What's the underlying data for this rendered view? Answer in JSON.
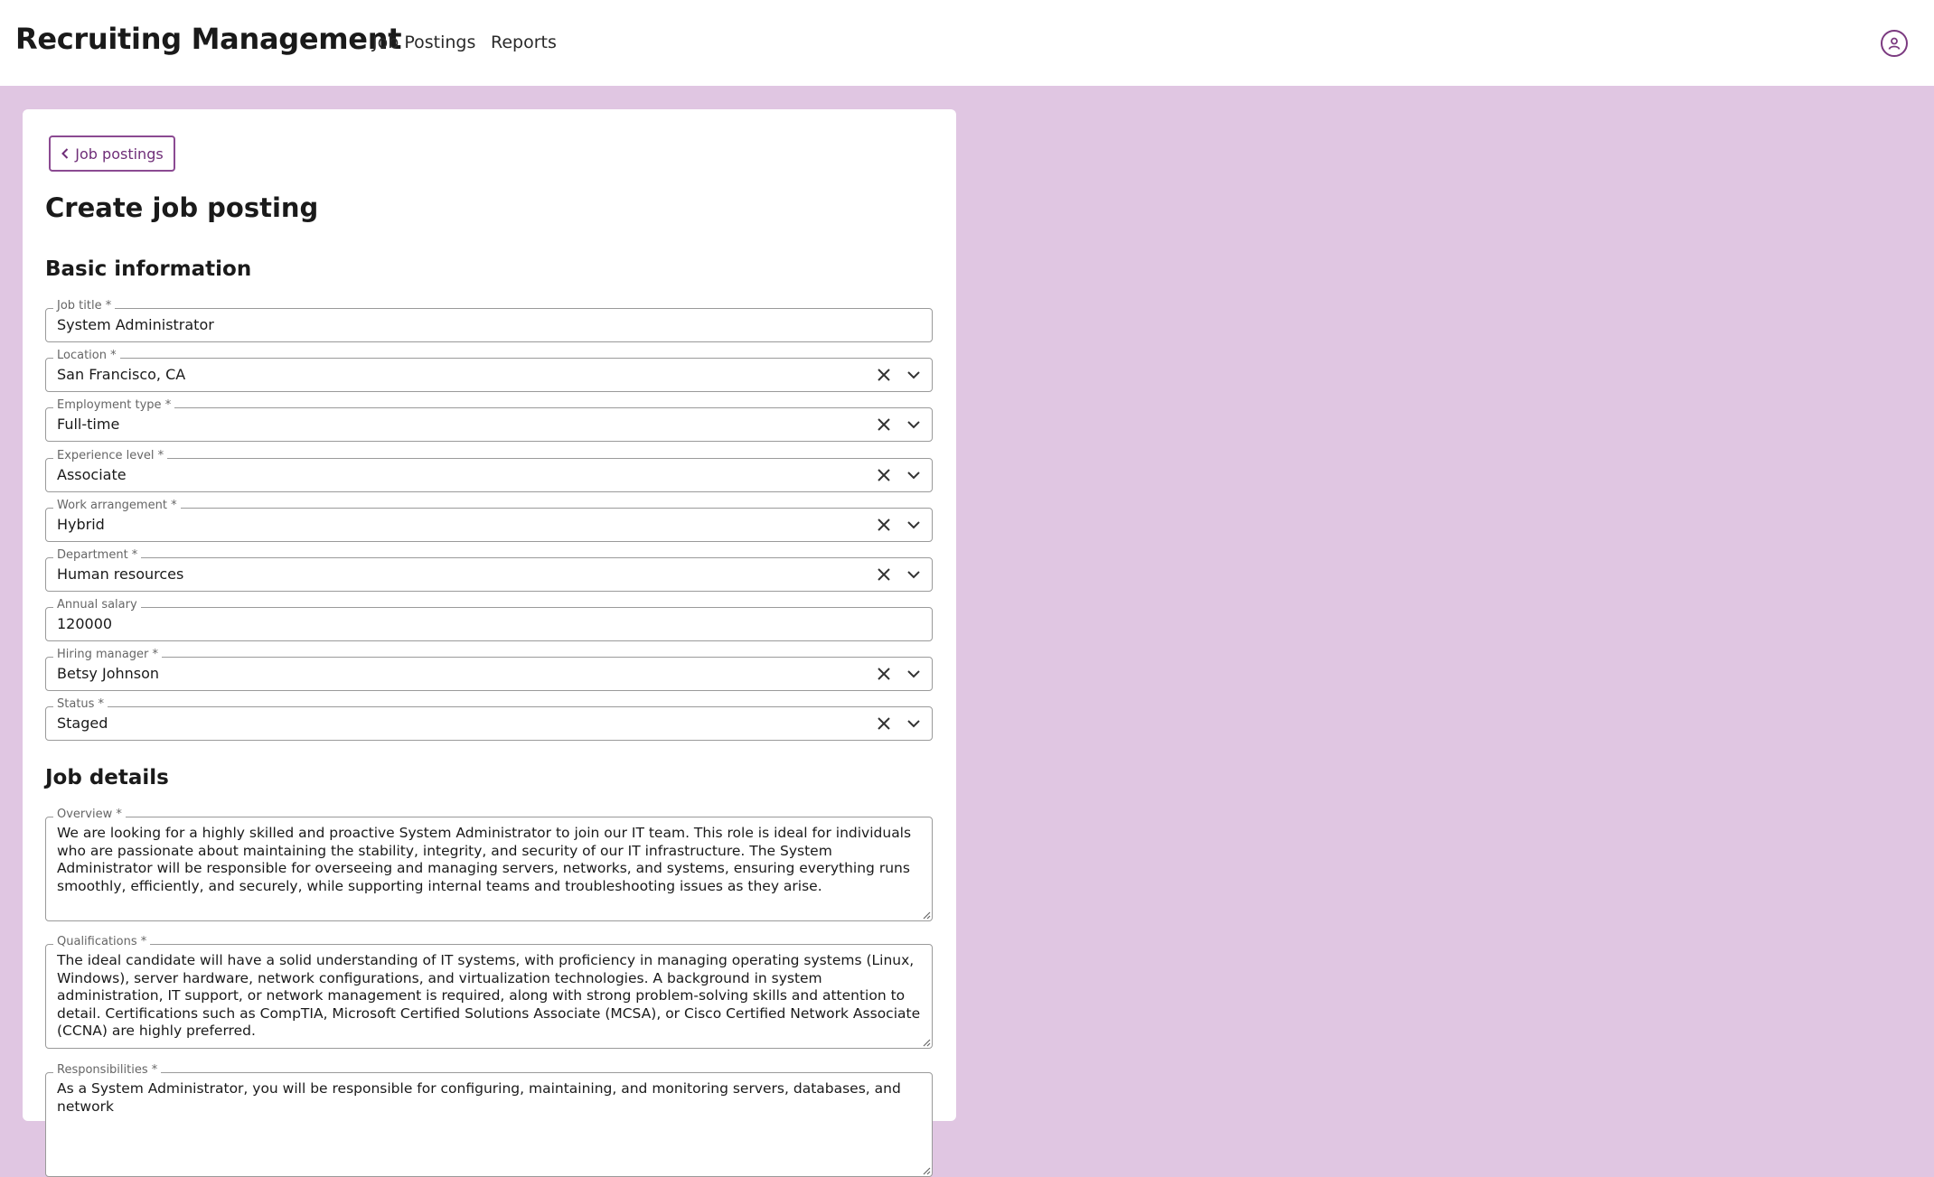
{
  "header": {
    "app_title": "Recruiting Management",
    "nav": [
      "Job Postings",
      "Reports"
    ],
    "user_icon": "user-circle-icon"
  },
  "card": {
    "back_label": "Job postings",
    "page_title": "Create job posting",
    "basic_section": "Basic information",
    "details_section": "Job details"
  },
  "fields": [
    {
      "label": "Job title *",
      "value": "System Administrator",
      "type": "text"
    },
    {
      "label": "Location *",
      "value": "San Francisco, CA",
      "type": "select"
    },
    {
      "label": "Employment type *",
      "value": "Full-time",
      "type": "select"
    },
    {
      "label": "Experience level *",
      "value": "Associate",
      "type": "select"
    },
    {
      "label": "Work arrangement *",
      "value": "Hybrid",
      "type": "select"
    },
    {
      "label": "Department *",
      "value": "Human resources",
      "type": "select"
    },
    {
      "label": "Annual salary",
      "value": "120000",
      "type": "text"
    },
    {
      "label": "Hiring manager *",
      "value": "Betsy Johnson",
      "type": "select"
    },
    {
      "label": "Status *",
      "value": "Staged",
      "type": "select"
    }
  ],
  "textareas": [
    {
      "label": "Overview *",
      "value": "We are looking for a highly skilled and proactive System Administrator to join our IT team. This role is ideal for individuals who are passionate about maintaining the stability, integrity, and security of our IT infrastructure. The System Administrator will be responsible for overseeing and managing servers, networks, and systems, ensuring everything runs smoothly, efficiently, and securely, while supporting internal teams and troubleshooting issues as they arise."
    },
    {
      "label": "Qualifications *",
      "value": "The ideal candidate will have a solid understanding of IT systems, with proficiency in managing operating systems (Linux, Windows), server hardware, network configurations, and virtualization technologies. A background in system administration, IT support, or network management is required, along with strong problem-solving skills and attention to detail. Certifications such as CompTIA, Microsoft Certified Solutions Associate (MCSA), or Cisco Certified Network Associate (CCNA) are highly preferred."
    },
    {
      "label": "Responsibilities *",
      "value": "As a System Administrator, you will be responsible for configuring, maintaining, and monitoring servers, databases, and network"
    }
  ],
  "colors": {
    "accent": "#7b3a80",
    "background": "#e0c6e2"
  }
}
